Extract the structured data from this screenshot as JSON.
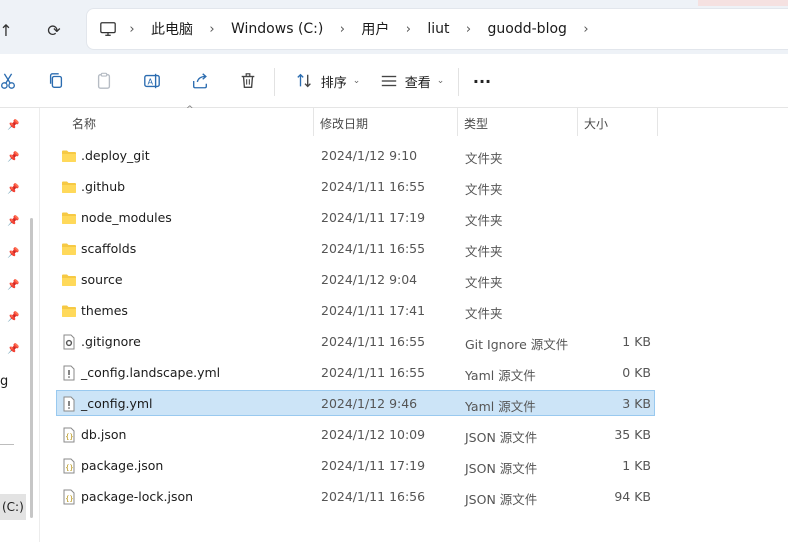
{
  "nav": {
    "up_glyph": "↑",
    "refresh_glyph": "⟳"
  },
  "breadcrumb": {
    "items": [
      "此电脑",
      "Windows (C:)",
      "用户",
      "liut",
      "guodd-blog"
    ],
    "separator": "›"
  },
  "toolbar": {
    "sort_label": "排序",
    "view_label": "查看",
    "more_glyph": "···",
    "caret_glyph": "⌄"
  },
  "sidebar": {
    "partial_text_g": "g",
    "partial_drive": "(C:)"
  },
  "columns": {
    "name": "名称",
    "date": "修改日期",
    "type": "类型",
    "size": "大小"
  },
  "files": [
    {
      "name": ".deploy_git",
      "date": "2024/1/12 9:10",
      "type": "文件夹",
      "size": "",
      "icon": "folder-icon"
    },
    {
      "name": ".github",
      "date": "2024/1/11 16:55",
      "type": "文件夹",
      "size": "",
      "icon": "folder-icon"
    },
    {
      "name": "node_modules",
      "date": "2024/1/11 17:19",
      "type": "文件夹",
      "size": "",
      "icon": "folder-icon"
    },
    {
      "name": "scaffolds",
      "date": "2024/1/11 16:55",
      "type": "文件夹",
      "size": "",
      "icon": "folder-icon"
    },
    {
      "name": "source",
      "date": "2024/1/12 9:04",
      "type": "文件夹",
      "size": "",
      "icon": "folder-icon"
    },
    {
      "name": "themes",
      "date": "2024/1/11 17:41",
      "type": "文件夹",
      "size": "",
      "icon": "folder-icon"
    },
    {
      "name": ".gitignore",
      "date": "2024/1/11 16:55",
      "type": "Git Ignore 源文件",
      "size": "1 KB",
      "icon": "settings-file-icon"
    },
    {
      "name": "_config.landscape.yml",
      "date": "2024/1/11 16:55",
      "type": "Yaml 源文件",
      "size": "0 KB",
      "icon": "yaml-file-icon"
    },
    {
      "name": "_config.yml",
      "date": "2024/1/12 9:46",
      "type": "Yaml 源文件",
      "size": "3 KB",
      "icon": "yaml-file-icon"
    },
    {
      "name": "db.json",
      "date": "2024/1/12 10:09",
      "type": "JSON 源文件",
      "size": "35 KB",
      "icon": "json-file-icon"
    },
    {
      "name": "package.json",
      "date": "2024/1/11 17:19",
      "type": "JSON 源文件",
      "size": "1 KB",
      "icon": "json-file-icon"
    },
    {
      "name": "package-lock.json",
      "date": "2024/1/11 16:56",
      "type": "JSON 源文件",
      "size": "94 KB",
      "icon": "json-file-icon"
    }
  ],
  "selected_index": 8,
  "colors": {
    "accent": "#2b6cb0",
    "folder": "#f6c944",
    "selection": "#cce4f7",
    "selection_border": "#99c9ef"
  }
}
